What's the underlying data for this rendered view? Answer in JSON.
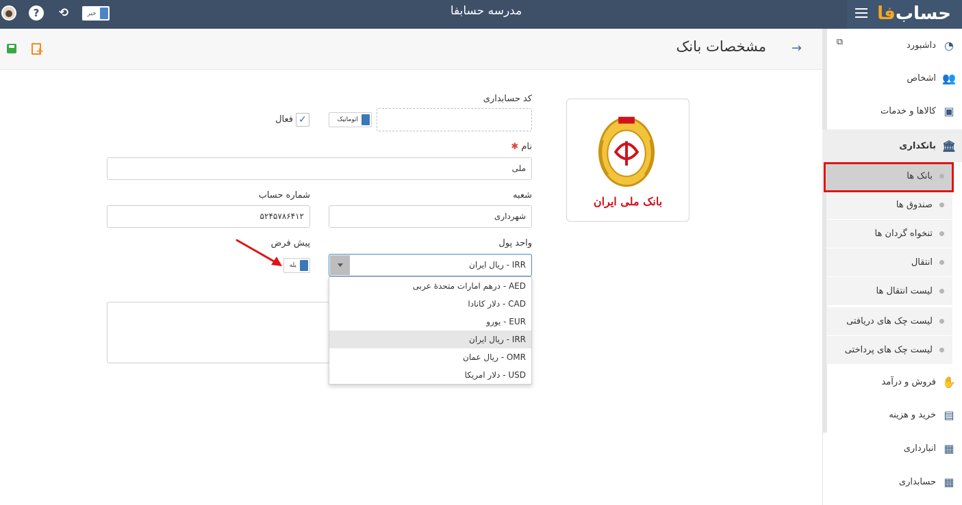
{
  "topbar": {
    "company_name": "مدرسه حسابفا",
    "logo_main": "حساب",
    "logo_accent": "فا",
    "toggle_label": "خیر",
    "help_glyph": "?",
    "sync_glyph": "⟲"
  },
  "sidebar": {
    "items": [
      {
        "label": "داشبورد",
        "icon": "dashboard-icon"
      },
      {
        "label": "اشخاص",
        "icon": "people-icon"
      },
      {
        "label": "کالاها و خدمات",
        "icon": "box-icon"
      },
      {
        "label": "بانکداری",
        "icon": "bank-icon"
      },
      {
        "label": "فروش و درآمد",
        "icon": "hand-money-icon"
      },
      {
        "label": "خرید و هزینه",
        "icon": "wallet-icon"
      },
      {
        "label": "انبارداری",
        "icon": "warehouse-icon"
      },
      {
        "label": "حسابداری",
        "icon": "calculator-icon"
      }
    ],
    "sub_items": [
      {
        "label": "بانک ها"
      },
      {
        "label": "صندوق ها"
      },
      {
        "label": "تنخواه گردان ها"
      },
      {
        "label": "انتقال"
      },
      {
        "label": "لیست انتقال ها"
      },
      {
        "label": "لیست چک های دریافتی"
      },
      {
        "label": "لیست چک های پرداختی"
      }
    ]
  },
  "page": {
    "title": "مشخصات بانک"
  },
  "form": {
    "accounting_code_label": "کد حسابداری",
    "auto_label": "اتوماتیک",
    "active_label": "فعال",
    "name_label": "نام",
    "name_value": "ملی",
    "branch_label": "شعبه",
    "branch_value": "شهرداری",
    "account_number_label": "شماره حساب",
    "account_number_value": "۵۲۴۵۷۸۶۴۱۲",
    "currency_label": "واحد پول",
    "currency_value": "IRR - ریال ایران",
    "default_label": "پیش فرض",
    "default_toggle_label": "بله",
    "currency_options": [
      "AED - درهم امارات متحدهٔ عربی",
      "CAD - دلار کانادا",
      "EUR - یورو",
      "IRR - ریال ایران",
      "OMR - ریال عمان",
      "USD - دلار امریکا"
    ],
    "selected_option_index": 3
  },
  "bank_logo": {
    "caption": "بانک ملی ایران"
  },
  "colors": {
    "topbar": "#3d5068",
    "accent_orange": "#f5a623",
    "highlight_red": "#e01414",
    "toggle_blue": "#3a78b8"
  }
}
